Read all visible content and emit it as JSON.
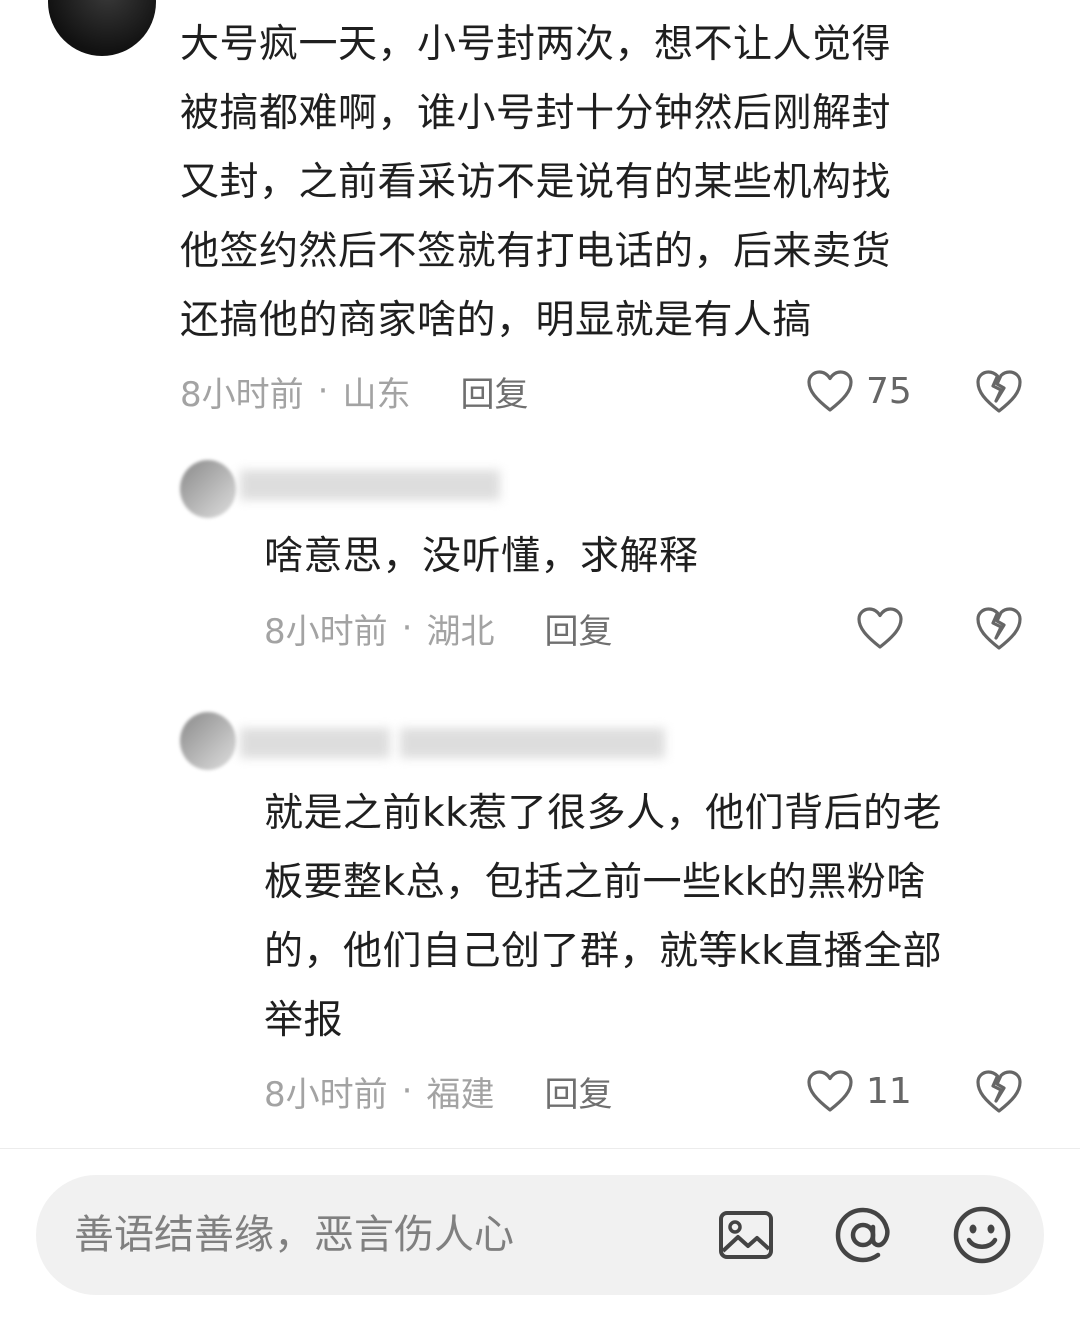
{
  "comments": [
    {
      "text_lines": [
        "大号疯一天，小号封两次，想不让人觉得",
        "被搞都难啊，谁小号封十分钟然后刚解封",
        "又封，之前看采访不是说有的某些机构找",
        "他签约然后不签就有打电话的，后来卖货",
        "还搞他的商家啥的，明显就是有人搞"
      ],
      "time": "8小时前",
      "dot": "·",
      "location": "山东",
      "reply": "回复",
      "likes": "75"
    },
    {
      "text_lines": [
        "啥意思，没听懂，求解释"
      ],
      "time": "8小时前",
      "dot": "·",
      "location": "湖北",
      "reply": "回复",
      "likes": ""
    },
    {
      "text_lines": [
        "就是之前kk惹了很多人，他们背后的老",
        "板要整k总，包括之前一些kk的黑粉啥",
        "的，他们自己创了群，就等kk直播全部",
        "举报"
      ],
      "time": "8小时前",
      "dot": "·",
      "location": "福建",
      "reply": "回复",
      "likes": "11"
    }
  ],
  "input": {
    "placeholder": "善语结善缘，恶言伤人心"
  },
  "icons": {
    "like": "heart-outline-icon",
    "dislike": "broken-heart-icon",
    "image": "image-icon",
    "mention": "at-icon",
    "emoji": "smiley-icon"
  },
  "colors": {
    "meta": "#a3a3a3",
    "text": "#1f1f1f",
    "icon": "#666666",
    "input_bg": "#f1f1f1"
  }
}
